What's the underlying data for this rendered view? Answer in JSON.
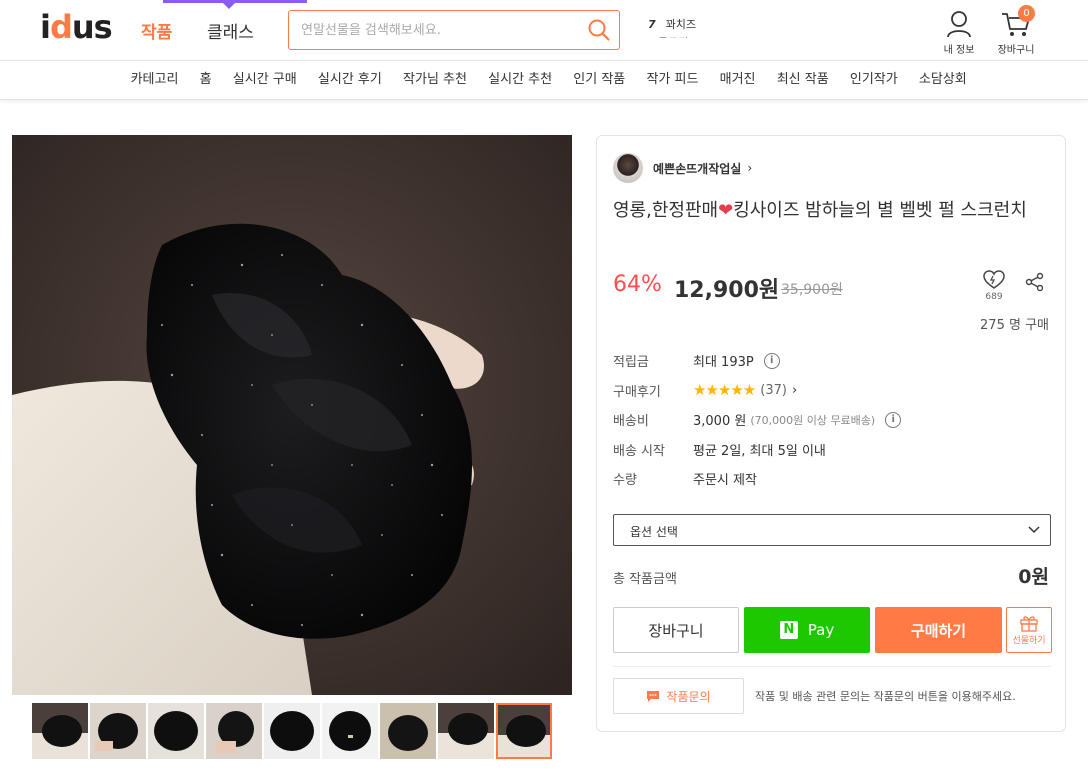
{
  "header": {
    "logo_text": "idus",
    "tab_works": "작품",
    "tab_classes": "클래스",
    "search_placeholder": "연말선물을 검색해보세요.",
    "ranking": [
      {
        "rank": "7",
        "keyword": "꽈치즈"
      },
      {
        "rank": "",
        "keyword": "목도리"
      }
    ],
    "my_info_label": "내 정보",
    "cart_label": "장바구니",
    "cart_count": "0"
  },
  "category_nav": [
    "카테고리",
    "홈",
    "실시간 구매",
    "실시간 후기",
    "작가님 추천",
    "실시간 추천",
    "인기 작품",
    "작가 피드",
    "매거진",
    "최신 작품",
    "인기작가",
    "소담상회"
  ],
  "product": {
    "artist_name": "예쁜손뜨개작업실",
    "title_part1": "영롱,한정판매",
    "title_part2": "킹사이즈 밤하늘의 별 벨벳 펄 스크런치",
    "discount": "64%",
    "price": "12,900원",
    "original_price": "35,900원",
    "favorite_count": "689",
    "purchase_count": "275 명 구매",
    "info": {
      "points_label": "적립금",
      "points_value": "최대 193P",
      "reviews_label": "구매후기",
      "reviews_stars": "★★★★★",
      "reviews_count": "(37)",
      "shipping_label": "배송비",
      "shipping_value": "3,000 원",
      "shipping_note": "(70,000원 이상 무료배송)",
      "ship_start_label": "배송 시작",
      "ship_start_value": "평균 2일, 최대 5일 이내",
      "quantity_label": "수량",
      "quantity_value": "주문시 제작"
    },
    "option_select": "옵션 선택",
    "total_label": "총 작품금액",
    "total_value": "0원",
    "buttons": {
      "cart": "장바구니",
      "npay": "Pay",
      "buy": "구매하기",
      "gift": "선물하기"
    },
    "inquiry_button": "작품문의",
    "inquiry_note": "작품 및 배송 관련 문의는 작품문의 버튼을 이용해주세요."
  },
  "colors": {
    "accent": "#ff7a45",
    "discount": "#ff4d4d",
    "npay_green": "#1ec800",
    "active_tab_bar": "#8b5cf6"
  }
}
